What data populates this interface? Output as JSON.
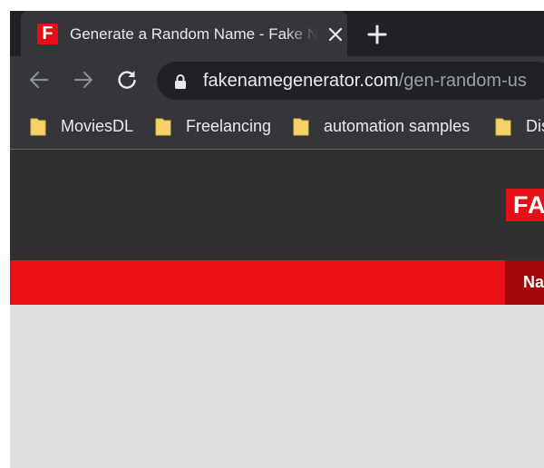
{
  "browser": {
    "tab": {
      "favicon_letter": "F",
      "title": "Generate a Random Name - Fake Name Generator"
    },
    "address_bar": {
      "host": "fakenamegenerator.com",
      "path": "/gen-random-us"
    },
    "bookmarks": [
      {
        "label": "MoviesDL"
      },
      {
        "label": "Freelancing"
      },
      {
        "label": "automation samples"
      },
      {
        "label": "Dis"
      }
    ]
  },
  "site": {
    "logo_text": "FAKE",
    "nav": {
      "first_item": "Name"
    }
  },
  "colors": {
    "tabstrip_bg": "#202124",
    "toolbar_bg": "#35363a",
    "brand_red": "#e60f17",
    "nav_active": "#a50709",
    "header_bg": "#303030"
  }
}
